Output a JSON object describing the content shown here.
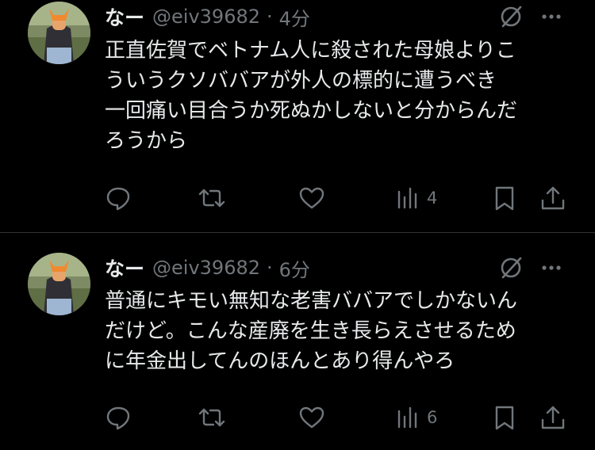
{
  "colors": {
    "background": "#000000",
    "text_primary": "#e7e9ea",
    "text_secondary": "#71767b",
    "divider": "#2f3336"
  },
  "tweets": [
    {
      "display_name": "なー",
      "handle": "@eiv39682",
      "separator": "·",
      "time": "4分",
      "lines": [
        "正直佐賀でベトナム人に殺された母娘よりこ",
        "ういうクソババアが外人の標的に遭うべき",
        "一回痛い目合うか死ぬかしないと分からんだ",
        "ろうから"
      ],
      "views": "4",
      "icons": [
        "grok-icon",
        "more-icon",
        "reply-icon",
        "retweet-icon",
        "like-icon",
        "views-icon",
        "bookmark-icon",
        "share-icon"
      ]
    },
    {
      "display_name": "なー",
      "handle": "@eiv39682",
      "separator": "·",
      "time": "6分",
      "lines": [
        "普通にキモい無知な老害ババアでしかないん",
        "だけど。こんな産廃を生き長らえさせるため",
        "に年金出してんのほんとあり得んやろ"
      ],
      "views": "6",
      "icons": [
        "grok-icon",
        "more-icon",
        "reply-icon",
        "retweet-icon",
        "like-icon",
        "views-icon",
        "bookmark-icon",
        "share-icon"
      ]
    }
  ]
}
